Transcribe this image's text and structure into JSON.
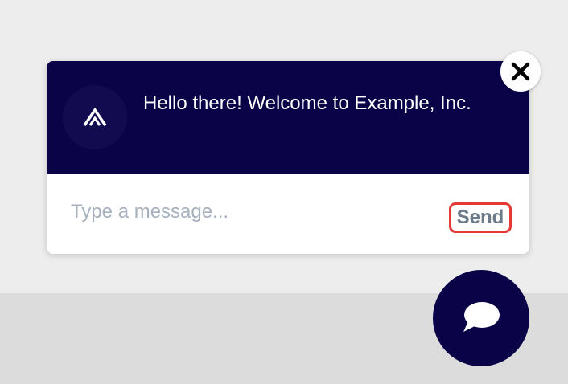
{
  "chat": {
    "greeting": "Hello there! Welcome to Example, Inc.",
    "input_placeholder": "Type a message...",
    "send_label": "Send"
  },
  "icons": {
    "avatar": "brand-logo-icon",
    "close": "close-icon",
    "launcher": "chat-bubble-icon"
  },
  "colors": {
    "header_background": "#0a0348",
    "send_highlight_border": "#e53935",
    "send_text": "#6d7a8a",
    "placeholder_text": "#a7b0bd"
  }
}
